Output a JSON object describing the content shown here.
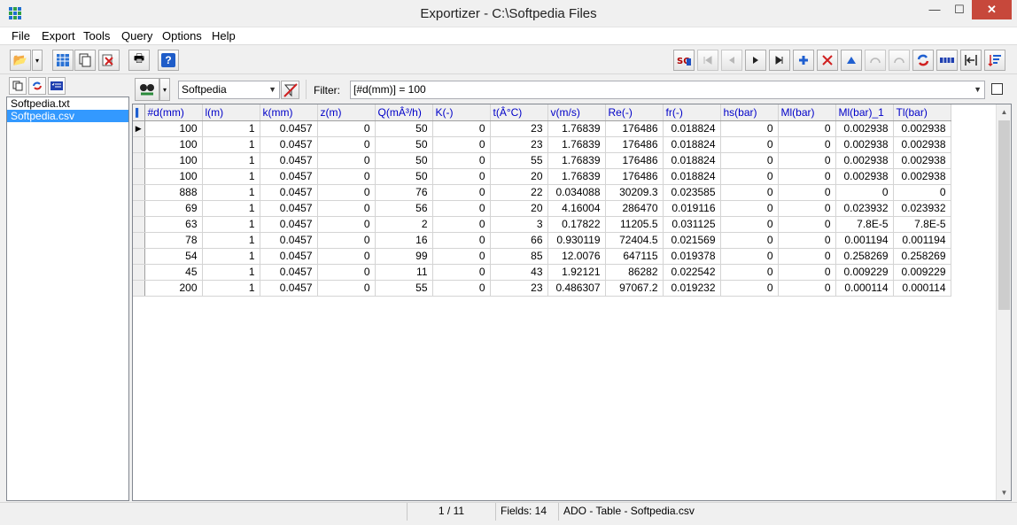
{
  "window": {
    "title": "Exportizer - C:\\Softpedia Files",
    "min": "—",
    "max": "☐",
    "close": "✕"
  },
  "menu": [
    "File",
    "Export",
    "Tools",
    "Query",
    "Options",
    "Help"
  ],
  "toolbar": {
    "open_icon": "📂",
    "drop": "▾",
    "print_icon": "🖶",
    "help_icon": "?"
  },
  "filelist": {
    "items": [
      "Softpedia.txt",
      "Softpedia.csv"
    ],
    "selected": 1
  },
  "filter": {
    "source": "Softpedia",
    "label": "Filter:",
    "expression": "[#d(mm)] = 100"
  },
  "grid": {
    "columns": [
      "#d(mm)",
      "l(m)",
      "k(mm)",
      "z(m)",
      "Q(mÂ³/h)",
      "K(-)",
      "t(Â°C)",
      "v(m/s)",
      "Re(-)",
      "fr(-)",
      "hs(bar)",
      "Ml(bar)",
      "Ml(bar)_1",
      "Tl(bar)"
    ],
    "rows": [
      [
        "100",
        "1",
        "0.0457",
        "0",
        "50",
        "0",
        "23",
        "1.76839",
        "176486",
        "0.018824",
        "0",
        "0",
        "0.002938",
        "0.002938"
      ],
      [
        "100",
        "1",
        "0.0457",
        "0",
        "50",
        "0",
        "23",
        "1.76839",
        "176486",
        "0.018824",
        "0",
        "0",
        "0.002938",
        "0.002938"
      ],
      [
        "100",
        "1",
        "0.0457",
        "0",
        "50",
        "0",
        "55",
        "1.76839",
        "176486",
        "0.018824",
        "0",
        "0",
        "0.002938",
        "0.002938"
      ],
      [
        "100",
        "1",
        "0.0457",
        "0",
        "50",
        "0",
        "20",
        "1.76839",
        "176486",
        "0.018824",
        "0",
        "0",
        "0.002938",
        "0.002938"
      ],
      [
        "888",
        "1",
        "0.0457",
        "0",
        "76",
        "0",
        "22",
        "0.034088",
        "30209.3",
        "0.023585",
        "0",
        "0",
        "0",
        "0"
      ],
      [
        "69",
        "1",
        "0.0457",
        "0",
        "56",
        "0",
        "20",
        "4.16004",
        "286470",
        "0.019116",
        "0",
        "0",
        "0.023932",
        "0.023932"
      ],
      [
        "63",
        "1",
        "0.0457",
        "0",
        "2",
        "0",
        "3",
        "0.17822",
        "11205.5",
        "0.031125",
        "0",
        "0",
        "7.8E-5",
        "7.8E-5"
      ],
      [
        "78",
        "1",
        "0.0457",
        "0",
        "16",
        "0",
        "66",
        "0.930119",
        "72404.5",
        "0.021569",
        "0",
        "0",
        "0.001194",
        "0.001194"
      ],
      [
        "54",
        "1",
        "0.0457",
        "0",
        "99",
        "0",
        "85",
        "12.0076",
        "647115",
        "0.019378",
        "0",
        "0",
        "0.258269",
        "0.258269"
      ],
      [
        "45",
        "1",
        "0.0457",
        "0",
        "11",
        "0",
        "43",
        "1.92121",
        "86282",
        "0.022542",
        "0",
        "0",
        "0.009229",
        "0.009229"
      ],
      [
        "200",
        "1",
        "0.0457",
        "0",
        "55",
        "0",
        "23",
        "0.486307",
        "97067.2",
        "0.019232",
        "0",
        "0",
        "0.000114",
        "0.000114"
      ]
    ],
    "current_row": 0
  },
  "status": {
    "record": "1 / 11",
    "fields": "Fields: 14",
    "source": "ADO - Table - Softpedia.csv"
  }
}
